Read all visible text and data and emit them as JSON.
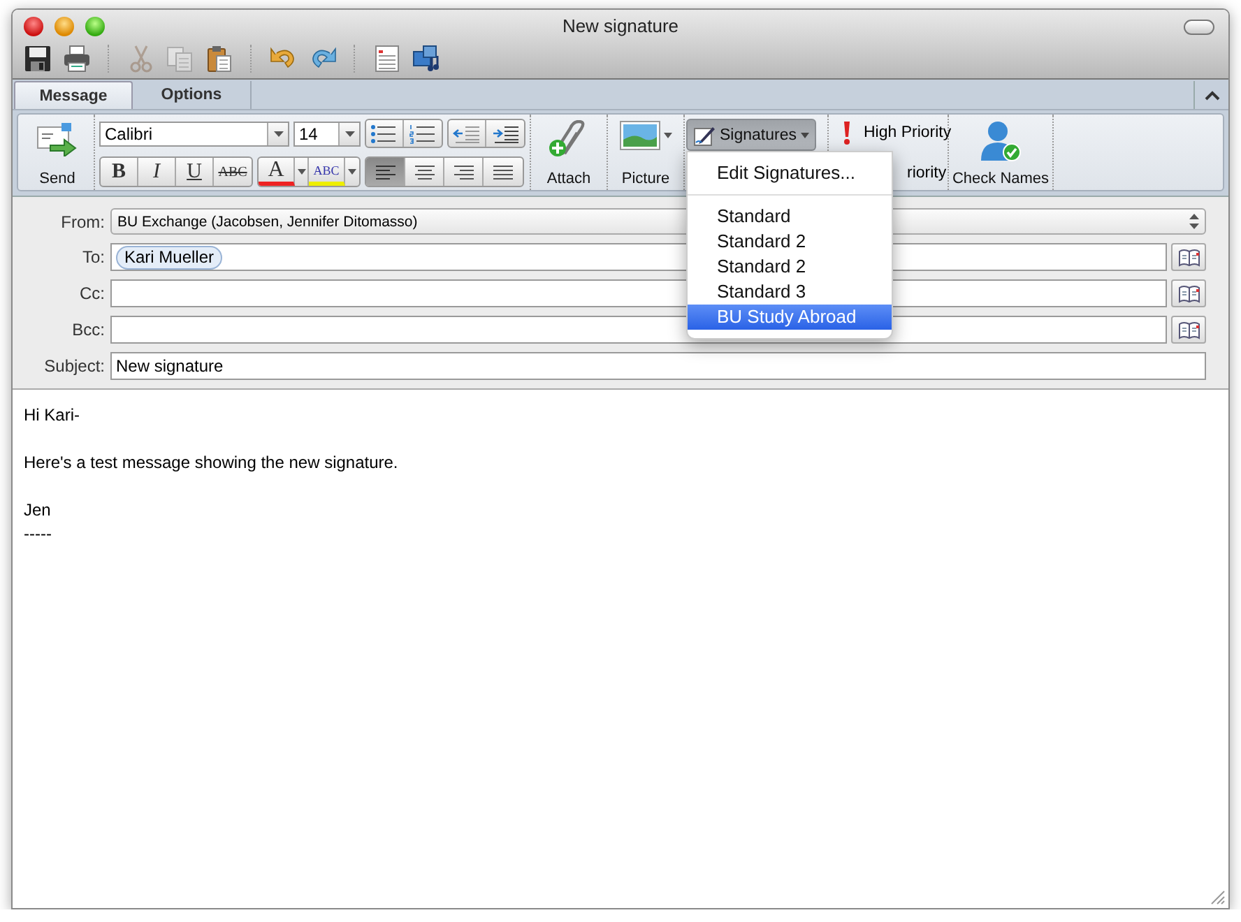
{
  "window": {
    "title": "New signature"
  },
  "toolbar": [
    {
      "kind": "save",
      "disabled": false
    },
    {
      "kind": "print",
      "disabled": false
    },
    {
      "kind": "cut",
      "disabled": true
    },
    {
      "kind": "copy",
      "disabled": true
    },
    {
      "kind": "paste",
      "disabled": false
    },
    {
      "kind": "undo",
      "disabled": false
    },
    {
      "kind": "redo",
      "disabled": false
    },
    {
      "kind": "form",
      "disabled": false
    },
    {
      "kind": "media",
      "disabled": false
    }
  ],
  "tabs": [
    {
      "label": "Message",
      "selected": true
    },
    {
      "label": "Options",
      "selected": false
    }
  ],
  "ribbon": {
    "send": "Send",
    "font": "Calibri",
    "size": "14",
    "styles": [
      {
        "label": "B",
        "kind": "bold"
      },
      {
        "label": "I",
        "kind": "italic"
      },
      {
        "label": "U",
        "kind": "underline"
      },
      {
        "label": "ABC",
        "kind": "strike"
      }
    ],
    "font_color": "A",
    "highlight": "ABC",
    "alignment": [
      {
        "kind": "left",
        "selected": true
      },
      {
        "kind": "center",
        "selected": false
      },
      {
        "kind": "right",
        "selected": false
      },
      {
        "kind": "justify",
        "selected": false
      }
    ],
    "attach": "Attach",
    "picture": "Picture",
    "signatures": "Signatures",
    "high_priority": "High Priority",
    "low_priority": "riority",
    "check_names": "Check Names"
  },
  "signatures_menu": [
    {
      "kind": "command",
      "label": "Edit Signatures...",
      "selected": false
    },
    {
      "kind": "signature",
      "label": "Standard",
      "selected": false
    },
    {
      "kind": "signature",
      "label": "Standard 2",
      "selected": false
    },
    {
      "kind": "signature",
      "label": "Standard 2",
      "selected": false
    },
    {
      "kind": "signature",
      "label": "Standard 3",
      "selected": false
    },
    {
      "kind": "signature",
      "label": "BU Study Abroad",
      "selected": true
    }
  ],
  "from": {
    "label": "From:",
    "value": "BU Exchange (Jacobsen, Jennifer Ditomasso)"
  },
  "recipients": [
    {
      "label": "To:",
      "tokens": [
        "Kari Mueller"
      ]
    },
    {
      "label": "Cc:"
    },
    {
      "label": "Bcc:"
    }
  ],
  "subject": {
    "label": "Subject:",
    "value": "New signature"
  },
  "body": [
    [
      "Hi Kari-"
    ],
    [
      "Here's a test message showing the new signature."
    ],
    [
      "Jen",
      "-----"
    ]
  ]
}
